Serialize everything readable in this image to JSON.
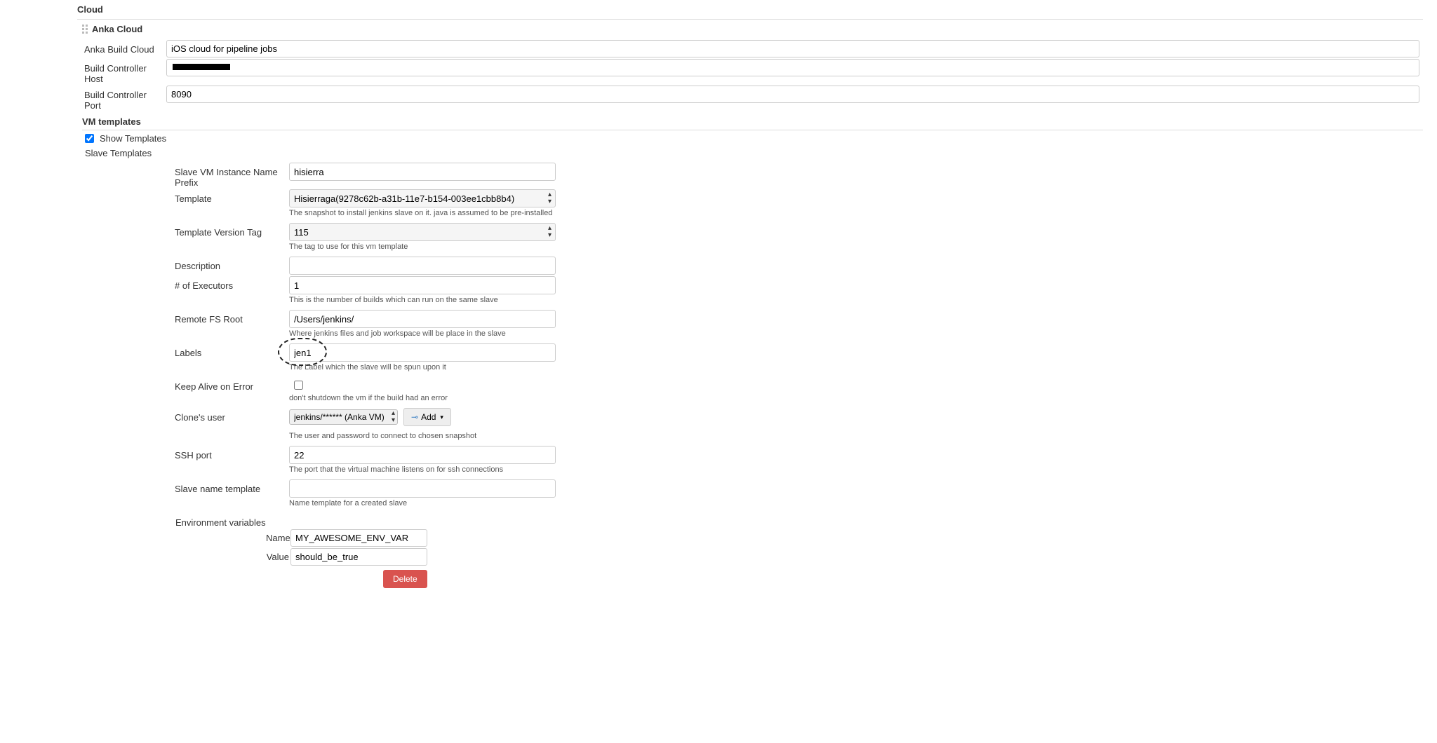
{
  "headings": {
    "cloud": "Cloud",
    "anka_cloud": "Anka Cloud",
    "vm_templates": "VM templates"
  },
  "cloud": {
    "build_cloud_label": "Anka Build Cloud",
    "build_cloud_value": "iOS cloud for pipeline jobs",
    "host_label": "Build Controller Host",
    "host_value": "",
    "port_label": "Build Controller Port",
    "port_value": "8090"
  },
  "vm": {
    "show_templates_label": "Show Templates",
    "slave_templates_label": "Slave Templates"
  },
  "tmpl": {
    "prefix_label": "Slave VM Instance Name Prefix",
    "prefix_value": "hisierra",
    "template_label": "Template",
    "template_value": "Hisierraga(9278c62b-a31b-11e7-b154-003ee1cbb8b4)",
    "template_hint": "The snapshot to install jenkins slave on it. java is assumed to be pre-installed",
    "version_label": "Template Version Tag",
    "version_value": "115",
    "version_hint": "The tag to use for this vm template",
    "desc_label": "Description",
    "desc_value": "",
    "exec_label": "# of Executors",
    "exec_value": "1",
    "exec_hint": "This is the number of builds which can run on the same slave",
    "fs_label": "Remote FS Root",
    "fs_value": "/Users/jenkins/",
    "fs_hint": "Where jenkins files and job workspace will be place in the slave",
    "labels_label": "Labels",
    "labels_value": "jen1",
    "labels_hint": "The Label which the slave will be spun upon it",
    "keep_label": "Keep Alive on Error",
    "keep_hint": "don't shutdown the vm if the build had an error",
    "clone_label": "Clone's user",
    "clone_value": "jenkins/****** (Anka VM)",
    "clone_hint": "The user and password to connect to chosen snapshot",
    "add_label": "Add",
    "ssh_label": "SSH port",
    "ssh_value": "22",
    "ssh_hint": "The port that the virtual machine listens on for ssh connections",
    "name_tmpl_label": "Slave name template",
    "name_tmpl_value": "",
    "name_tmpl_hint": "Name template for a created slave",
    "env_heading": "Environment variables",
    "env_name_label": "Name",
    "env_name_value": "MY_AWESOME_ENV_VAR",
    "env_value_label": "Value",
    "env_value_value": "should_be_true",
    "delete_label": "Delete"
  }
}
